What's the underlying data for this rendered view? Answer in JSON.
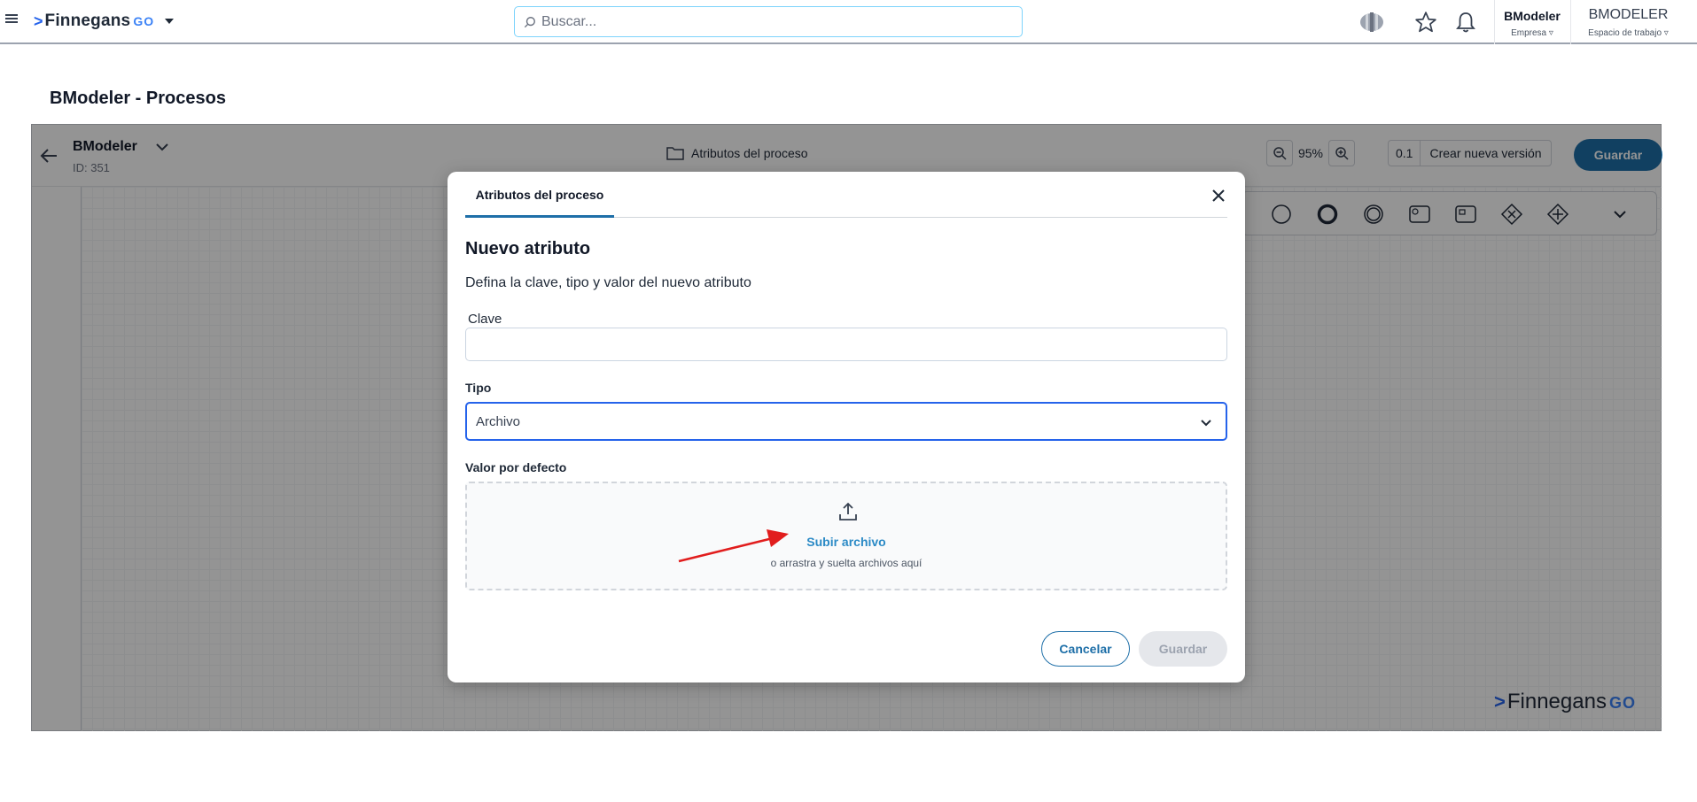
{
  "topbar": {
    "brand": "Finnegans",
    "brand_suffix": "GO",
    "search_placeholder": "Buscar...",
    "icons": [
      "apps-orb-icon",
      "star-icon",
      "bell-icon"
    ],
    "company": {
      "name": "BModeler",
      "label": "Empresa"
    },
    "workspace": {
      "name": "BMODELER",
      "label": "Espacio de trabajo"
    }
  },
  "page": {
    "title": "BModeler - Procesos"
  },
  "editor": {
    "process_name": "BModeler",
    "process_id": "ID: 351",
    "attributes_link": "Atributos del proceso",
    "zoom": "95%",
    "version": "0.1",
    "new_version_label": "Crear nueva versión",
    "save_label": "Guardar",
    "palette": [
      "start-event-icon",
      "end-event-icon",
      "intermediate-event-icon",
      "task-icon",
      "user-task-icon",
      "exclusive-gateway-icon",
      "parallel-gateway-icon",
      "more-chevron-icon"
    ],
    "watermark_brand": "Finnegans",
    "watermark_suffix": "GO"
  },
  "modal": {
    "tab": "Atributos del proceso",
    "title": "Nuevo atributo",
    "description": "Defina la clave, tipo y valor del nuevo atributo",
    "key_label": "Clave",
    "key_value": "",
    "type_label": "Tipo",
    "type_value": "Archivo",
    "default_label": "Valor por defecto",
    "upload_link": "Subir archivo",
    "upload_hint": "o arrastra y suelta archivos aquí",
    "cancel_label": "Cancelar",
    "save_label": "Guardar"
  },
  "colors": {
    "accent": "#1e6fa8",
    "link": "#2b8ac6",
    "select_border": "#2563eb",
    "annotation_arrow": "#e11d1d"
  }
}
